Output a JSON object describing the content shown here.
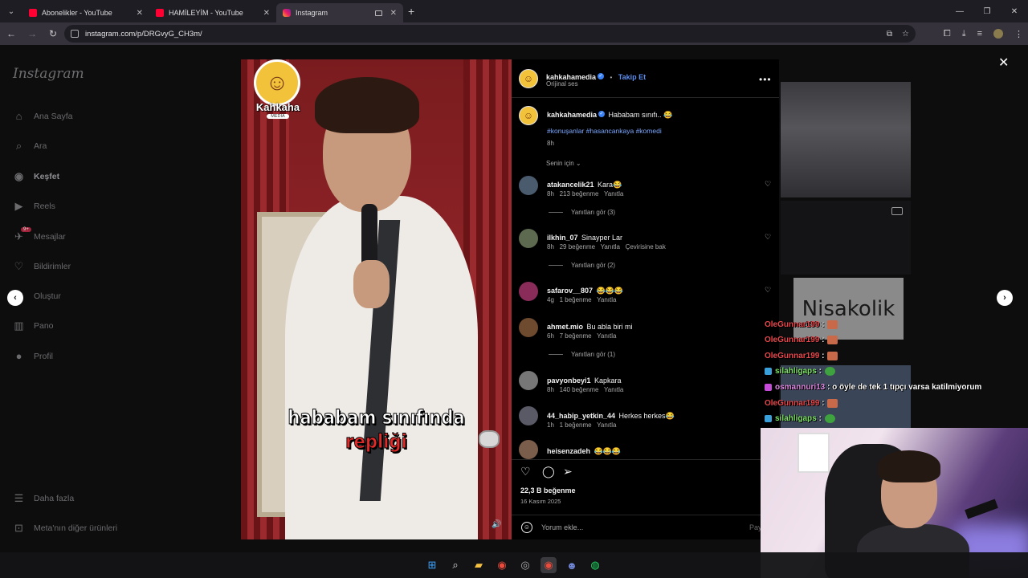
{
  "browser": {
    "tabs": [
      {
        "label": "Abonelikler - YouTube",
        "type": "yt",
        "active": false
      },
      {
        "label": "HAMİLEYİM - YouTube",
        "type": "yt",
        "active": false
      },
      {
        "label": "Instagram",
        "type": "ig",
        "active": true
      }
    ],
    "new_tab": "+",
    "url": "instagram.com/p/DRGvyG_CH3m/"
  },
  "instagram": {
    "logo": "Instagram",
    "sidebar": [
      {
        "label": "Ana Sayfa",
        "icon": "home-icon"
      },
      {
        "label": "Ara",
        "icon": "search-icon"
      },
      {
        "label": "Keşfet",
        "icon": "compass-icon"
      },
      {
        "label": "Reels",
        "icon": "reels-icon"
      },
      {
        "label": "Mesajlar",
        "icon": "messenger-icon",
        "badge": "9+"
      },
      {
        "label": "Bildirimler",
        "icon": "heart-icon"
      },
      {
        "label": "Oluştur",
        "icon": "plus-square-icon"
      },
      {
        "label": "Pano",
        "icon": "dashboard-icon"
      },
      {
        "label": "Profil",
        "icon": "profile-icon"
      }
    ],
    "sidebar_bottom": [
      {
        "label": "Daha fazla",
        "icon": "menu-icon"
      },
      {
        "label": "Meta'nın diğer ürünleri",
        "icon": "grid-icon"
      }
    ]
  },
  "post": {
    "video": {
      "logo_text": "Kahkaha",
      "logo_sub": "MEDIA",
      "subtitle_line1": "hababam sınıfında",
      "subtitle_line2": "repliği"
    },
    "header": {
      "username": "kahkahamedia",
      "follow": "Takip Et",
      "audio": "Orijinal ses",
      "separator": "•"
    },
    "caption": {
      "username": "kahkahamedia",
      "text": "Hababam sınıfı.. 😂",
      "hashtags": "#konuşanlar #hasancankaya #komedi",
      "time": "8h"
    },
    "sort_label": "Senin için",
    "comments": [
      {
        "user": "atakancelik21",
        "text": "Kara😂",
        "time": "8h",
        "likes": "213 beğenme",
        "reply": "Yanıtla",
        "extra": "",
        "replies": "Yanıtları gör (3)"
      },
      {
        "user": "ilkhin_07",
        "text": "Sinayper Lar",
        "time": "8h",
        "likes": "29 beğenme",
        "reply": "Yanıtla",
        "extra": "Çevirisine bak",
        "replies": "Yanıtları gör (2)"
      },
      {
        "user": "safarov__807",
        "text": "😂😂😂",
        "time": "4g",
        "likes": "1 beğenme",
        "reply": "Yanıtla",
        "extra": "",
        "replies": ""
      },
      {
        "user": "ahmet.mio",
        "text": "Bu abla biri mi",
        "time": "6h",
        "likes": "7 beğenme",
        "reply": "Yanıtla",
        "extra": "",
        "replies": "Yanıtları gör (1)"
      },
      {
        "user": "pavyonbeyi1",
        "text": "Kapkara",
        "time": "8h",
        "likes": "140 beğenme",
        "reply": "Yanıtla",
        "extra": "",
        "replies": ""
      },
      {
        "user": "44_habip_yetkin_44",
        "text": "Herkes herkes😂",
        "time": "1h",
        "likes": "1 beğenme",
        "reply": "Yanıtla",
        "extra": "",
        "replies": ""
      },
      {
        "user": "heisenzadeh",
        "text": "😂😂😂",
        "time": "",
        "likes": "",
        "reply": "",
        "extra": "",
        "replies": ""
      }
    ],
    "likes_count": "22,3 B beğenme",
    "date": "16 Kasım 2025",
    "comment_placeholder": "Yorum ekle...",
    "post_button": "Pay"
  },
  "thumbnails": {
    "nisakolik_text": "Nisakolik"
  },
  "stream_chat": [
    {
      "user": "OleGunnar199",
      "msg": ":",
      "color": "#e5484d",
      "emote": "face"
    },
    {
      "user": "OleGunnar199",
      "msg": ":",
      "color": "#e5484d",
      "emote": "face"
    },
    {
      "user": "OleGunnar199",
      "msg": ":",
      "color": "#e5484d",
      "emote": "face"
    },
    {
      "user": "silahligaps",
      "msg": ":",
      "color": "#7fe36a",
      "emote": "pepe"
    },
    {
      "user": "osmannuri13",
      "msg": ": o öyle de tek 1 tıpçı varsa katilmiyorum",
      "color": "#e08be6",
      "emote": ""
    },
    {
      "user": "OleGunnar199",
      "msg": ":",
      "color": "#e5484d",
      "emote": "face"
    },
    {
      "user": "silahligaps",
      "msg": ":",
      "color": "#7fe36a",
      "emote": "pepe"
    }
  ]
}
